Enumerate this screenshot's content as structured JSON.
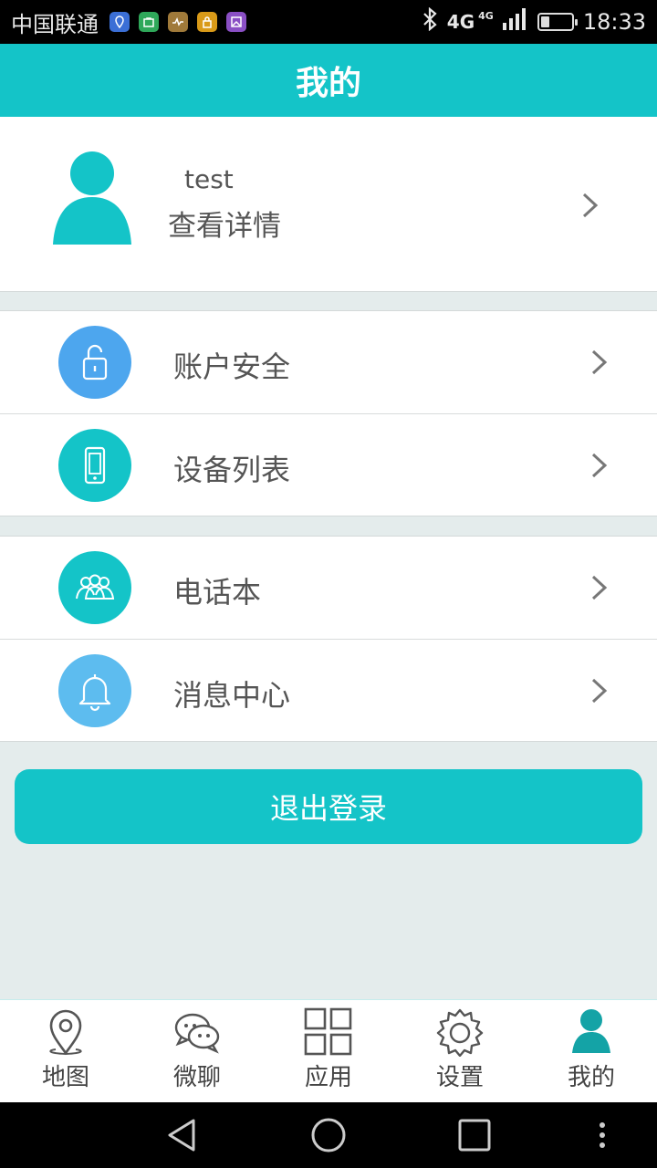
{
  "status_bar": {
    "carrier": "中国联通",
    "network": "4G",
    "network_small": "4G",
    "time": "18:33",
    "battery_level": 0.3,
    "notification_icons": [
      {
        "name": "location-app-icon",
        "color": "#3b6fd6"
      },
      {
        "name": "shopping-app-icon",
        "color": "#2fa85a"
      },
      {
        "name": "health-app-icon",
        "color": "#a07a3a"
      },
      {
        "name": "lock-app-icon",
        "color": "#d99a18"
      },
      {
        "name": "gallery-app-icon",
        "color": "#8a4fc4"
      }
    ]
  },
  "header": {
    "title": "我的"
  },
  "profile": {
    "name": "test",
    "link": "查看详情"
  },
  "menu_groups": [
    [
      {
        "label": "账户安全",
        "icon": "lock-icon",
        "color": "#4da6ee"
      },
      {
        "label": "设备列表",
        "icon": "phone-icon",
        "color": "#14c4c8"
      }
    ],
    [
      {
        "label": "电话本",
        "icon": "contacts-icon",
        "color": "#14c4c8"
      },
      {
        "label": "消息中心",
        "icon": "bell-icon",
        "color": "#5dbcef"
      }
    ]
  ],
  "logout_label": "退出登录",
  "tabs": [
    {
      "label": "地图",
      "icon": "map-pin-icon"
    },
    {
      "label": "微聊",
      "icon": "chat-icon"
    },
    {
      "label": "应用",
      "icon": "apps-grid-icon"
    },
    {
      "label": "设置",
      "icon": "gear-icon"
    },
    {
      "label": "我的",
      "icon": "person-icon",
      "active": true
    }
  ],
  "colors": {
    "accent": "#14c4c8",
    "background": "#e4ecec"
  }
}
